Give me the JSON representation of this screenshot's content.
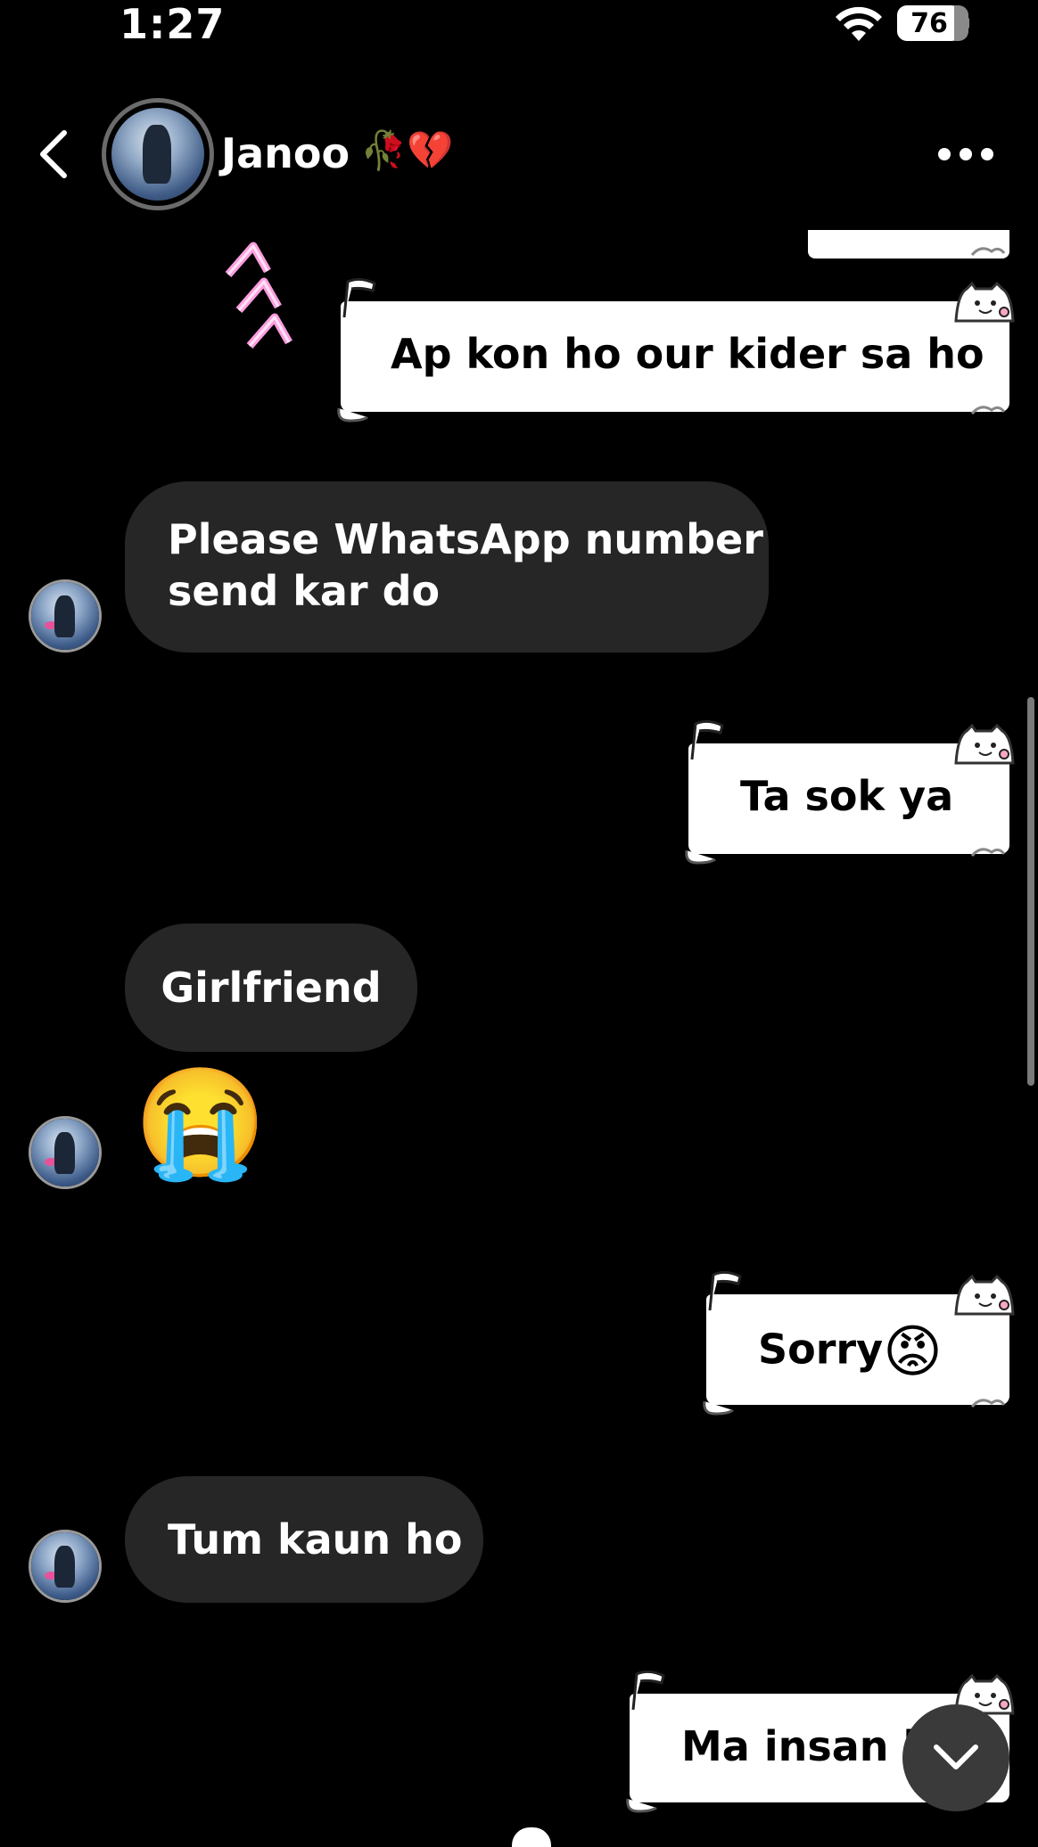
{
  "status_bar": {
    "time": "1:27",
    "battery": "76"
  },
  "header": {
    "title": "Janoo",
    "title_emoji": "🥀💔"
  },
  "messages": [
    {
      "direction": "sent",
      "text": "Ap kon ho our kider sa ho"
    },
    {
      "direction": "received",
      "lines": [
        "Please WhatsApp number",
        "send kar do"
      ]
    },
    {
      "direction": "sent",
      "text": "Ta sok ya"
    },
    {
      "direction": "received",
      "text": "Girlfriend"
    },
    {
      "direction": "received",
      "text": "😭"
    },
    {
      "direction": "sent",
      "text": "Sorry",
      "emoji": "😡"
    },
    {
      "direction": "received",
      "text": "Tum kaun ho"
    },
    {
      "direction": "sent",
      "text": "Ma insan h"
    }
  ],
  "icons": {
    "back": "chevron-left-icon",
    "more": "more-horizontal-icon",
    "jump": "chevron-down-icon",
    "wifi": "wifi-icon",
    "battery": "battery-icon"
  }
}
